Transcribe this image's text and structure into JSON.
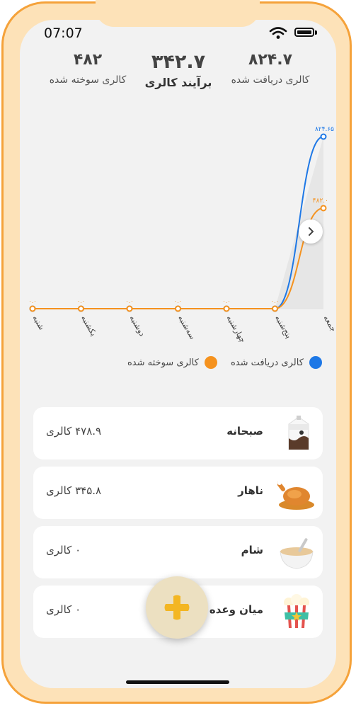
{
  "status_bar": {
    "time": "07:07"
  },
  "summary": {
    "burned": {
      "value": "۴۸۲",
      "label": "کالری سوخته شده"
    },
    "trend": {
      "value": "۳۴۲.۷",
      "label": "برآیند کالری"
    },
    "intake": {
      "value": "۸۲۴.۷",
      "label": "کالری دریافت شده"
    }
  },
  "chart_data": {
    "type": "line",
    "categories": [
      "جمعه",
      "پنج‌شنبه",
      "چهارشنبه",
      "سه‌شنبه",
      "دوشنبه",
      "یکشنبه",
      "شنبه"
    ],
    "series": [
      {
        "name": "کالری دریافت شده",
        "color": "#1e78e6",
        "values": [
          824.65,
          0,
          0,
          0,
          0,
          0,
          0
        ]
      },
      {
        "name": "کالری سوخته شده",
        "color": "#f5921e",
        "values": [
          482.0,
          0,
          0,
          0,
          0,
          0,
          0
        ]
      }
    ],
    "point_labels": {
      "intake_top": "۸۲۴.۶۵",
      "burned_top": "۴۸۲.۰",
      "zero": "۰.۰"
    },
    "ylim": [
      0,
      824.65
    ]
  },
  "legend": {
    "intake": "کالری دریافت شده",
    "burned": "کالری سوخته شده"
  },
  "meals": [
    {
      "name": "صبحانه",
      "calories": "۴۷۸.۹ کالری",
      "icon": "milk-carton-icon"
    },
    {
      "name": "ناهار",
      "calories": "۳۴۵.۸ کالری",
      "icon": "roast-chicken-icon"
    },
    {
      "name": "شام",
      "calories": "۰ کالری",
      "icon": "soup-bowl-icon"
    },
    {
      "name": "میان وعده",
      "calories": "۰ کالری",
      "icon": "popcorn-icon"
    }
  ],
  "colors": {
    "intake": "#1e78e6",
    "burned": "#f5921e",
    "frame": "#f5a23a",
    "bezel": "#fde2b8",
    "screen": "#f2f2f2",
    "fab": "#ece0c1",
    "fab_plus": "#f3b623"
  }
}
